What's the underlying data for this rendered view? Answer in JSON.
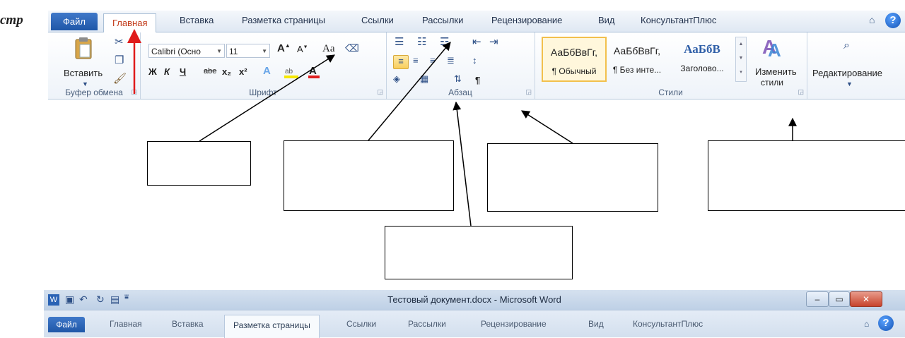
{
  "heading_fragment": "стр",
  "ribbon_top": {
    "file_tab": "Файл",
    "tabs": [
      "Главная",
      "Вставка",
      "Разметка страницы",
      "Ссылки",
      "Рассылки",
      "Рецензирование",
      "Вид",
      "КонсультантПлюс"
    ],
    "active_tab": "Главная",
    "help_glyph": "?",
    "minimize_glyph": "⌂",
    "clipboard": {
      "paste_label": "Вставить",
      "group_label": "Буфер обмена"
    },
    "font": {
      "font_name": "Calibri (Осно",
      "font_size": "11",
      "change_case": "Aa",
      "bold": "Ж",
      "italic": "К",
      "underline": "Ч",
      "strike": "abe",
      "subscript": "x₂",
      "superscript": "x²",
      "group_label": "Шрифт"
    },
    "paragraph": {
      "pilcrow": "¶",
      "group_label": "Абзац"
    },
    "styles": {
      "items": [
        {
          "sample": "АаБбВвГг,",
          "name": "¶ Обычный"
        },
        {
          "sample": "АаБбВвГг,",
          "name": "¶ Без инте..."
        },
        {
          "sample": "АаБбВ",
          "name": "Заголово..."
        }
      ],
      "change_styles_line1": "Изменить",
      "change_styles_line2": "стили",
      "group_label": "Стили"
    },
    "editing": {
      "label": "Редактирование"
    }
  },
  "ribbon_bottom": {
    "window_title": "Тестовый документ.docx - Microsoft Word",
    "file_tab": "Файл",
    "tabs": [
      "Главная",
      "Вставка",
      "Разметка страницы",
      "Ссылки",
      "Рассылки",
      "Рецензирование",
      "Вид",
      "КонсультантПлюс"
    ],
    "active_tab": "Разметка страницы"
  },
  "colors": {
    "file_tab": "#2a63b5",
    "highlight": "#f9cf5d",
    "font_color_underline": "#e02020",
    "annotation_red_arrow": "#e01b1b"
  }
}
